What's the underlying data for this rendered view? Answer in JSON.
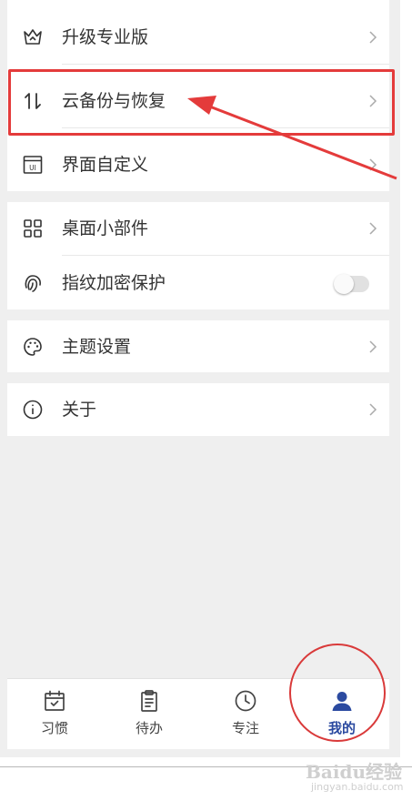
{
  "menu": {
    "group1": [
      {
        "label": "升级专业版",
        "icon": "crown-icon"
      },
      {
        "label": "云备份与恢复",
        "icon": "sync-arrows-icon"
      },
      {
        "label": "界面自定义",
        "icon": "ui-window-icon"
      }
    ],
    "group2": [
      {
        "label": "桌面小部件",
        "icon": "widgets-grid-icon"
      },
      {
        "label": "指纹加密保护",
        "icon": "fingerprint-icon",
        "toggle_on": false
      }
    ],
    "group3": [
      {
        "label": "主题设置",
        "icon": "palette-icon"
      }
    ],
    "group4": [
      {
        "label": "关于",
        "icon": "info-icon"
      }
    ]
  },
  "tabbar": {
    "tabs": [
      {
        "label": "习惯",
        "icon": "calendar-check-icon"
      },
      {
        "label": "待办",
        "icon": "clipboard-icon"
      },
      {
        "label": "专注",
        "icon": "clock-icon"
      },
      {
        "label": "我的",
        "icon": "user-icon",
        "active": true
      }
    ]
  },
  "colors": {
    "annotation_red": "#e43b3b",
    "active_tab": "#2b4aa0",
    "background": "#efefef"
  },
  "watermark": {
    "logo_text": "Baidu经验",
    "url": "jingyan.baidu.com"
  }
}
